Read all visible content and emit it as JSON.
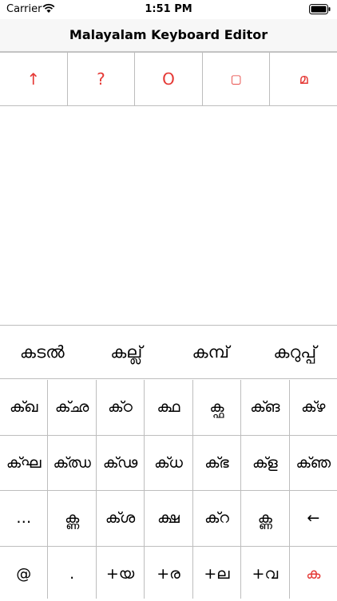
{
  "status_bar": {
    "carrier": "Carrier",
    "time": "1:51 PM"
  },
  "nav": {
    "title": "Malayalam Keyboard Editor"
  },
  "toolbar": {
    "buttons": [
      {
        "label": "↑",
        "name": "shift-button"
      },
      {
        "label": "?",
        "name": "help-button"
      },
      {
        "label": "O",
        "name": "circle-button"
      },
      {
        "label": "▢",
        "name": "rect-button"
      },
      {
        "label": "മ",
        "name": "malayalam-button"
      }
    ],
    "accent_color": "#e53935"
  },
  "suggestions": [
    "കടൽ",
    "കല്ല്",
    "കമ്പ്",
    "കറുപ്പ്"
  ],
  "keys": {
    "row1": [
      "ക്ഖ",
      "ക്ഛ",
      "ക്ഠ",
      "ക്ഥ",
      "ക്ഫ",
      "ക്ങ",
      "ക്ഴ"
    ],
    "row2": [
      "ക്ഘ",
      "ക്ഝ",
      "ക്ഢ",
      "ക്ധ",
      "ക്ഭ",
      "ക്ള",
      "ക്ഞ"
    ],
    "row3": [
      "…",
      "ക്ണ",
      "ക്ശ",
      "ക്ഷ",
      "ക്റ",
      "ക്ണ",
      "←"
    ],
    "row4": [
      "@",
      ".",
      "+യ",
      "+ര",
      "+ല",
      "+വ",
      "ക"
    ]
  }
}
